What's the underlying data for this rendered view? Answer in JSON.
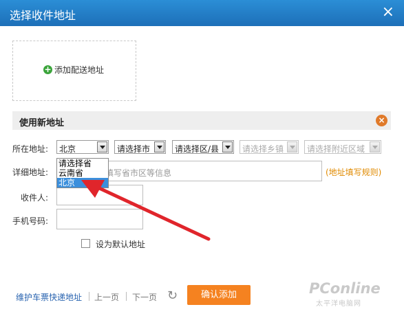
{
  "dialog": {
    "title": "选择收件地址",
    "close_glyph": "×"
  },
  "add_address": {
    "label": "添加配送地址"
  },
  "new_address": {
    "title": "使用新地址",
    "close_glyph": "×",
    "region_label": "所在地址:",
    "province": {
      "value": "北京"
    },
    "city": {
      "value": "请选择市"
    },
    "district": {
      "value": "请选择区/县"
    },
    "town": {
      "value": "请选择乡镇"
    },
    "nearby": {
      "value": "请选择附近区域"
    },
    "province_options": [
      "请选择省",
      "云南省",
      "北京"
    ],
    "detail_label": "详细地址:",
    "detail_placeholder": "填写省市区等信息",
    "rule_link": "(地址填写规则)",
    "receiver_label": "收件人:",
    "phone_label": "手机号码:",
    "default_checkbox_label": "设为默认地址"
  },
  "footer": {
    "maintain_link": "维护车票快递地址",
    "prev_page": "上一页",
    "next_page": "下一页",
    "refresh_glyph": "↻",
    "confirm_button": "确认添加"
  },
  "watermark": {
    "text": "PConline",
    "sub": "太平洋电脑网"
  },
  "colors": {
    "title_bar": "#1d6fb8",
    "accent_orange": "#f58220",
    "link_blue": "#2a64b0",
    "annotation_arrow": "#e0252b"
  }
}
